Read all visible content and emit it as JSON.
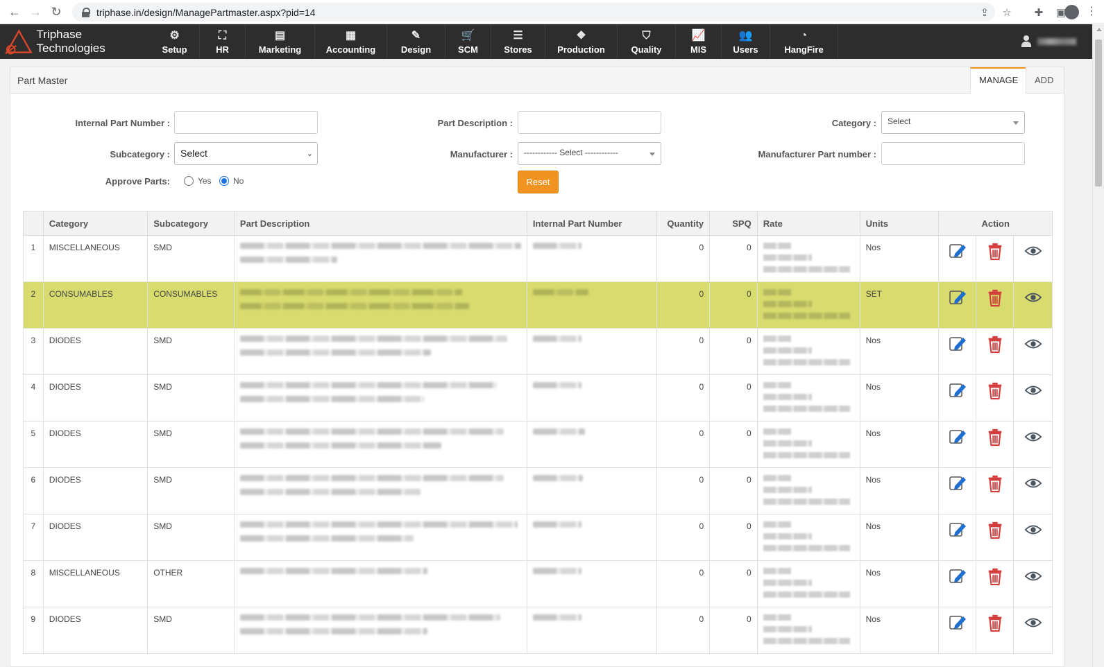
{
  "browser": {
    "url": "triphase.in/design/ManagePartmaster.aspx?pid=14"
  },
  "brand": {
    "name": "Triphase Technologies"
  },
  "nav": [
    {
      "label": "Setup",
      "icon": "gear-icon",
      "glyph": "⚙"
    },
    {
      "label": "HR",
      "icon": "org-chart-icon",
      "glyph": "⛶"
    },
    {
      "label": "Marketing",
      "icon": "briefcase-icon",
      "glyph": "▤"
    },
    {
      "label": "Accounting",
      "icon": "calculator-icon",
      "glyph": "▦"
    },
    {
      "label": "Design",
      "icon": "wrench-icon",
      "glyph": "✎"
    },
    {
      "label": "SCM",
      "icon": "cart-icon",
      "glyph": "🛒"
    },
    {
      "label": "Stores",
      "icon": "database-icon",
      "glyph": "☰"
    },
    {
      "label": "Production",
      "icon": "cubes-icon",
      "glyph": "❖"
    },
    {
      "label": "Quality",
      "icon": "shield-icon",
      "glyph": "⛉"
    },
    {
      "label": "MIS",
      "icon": "chart-icon",
      "glyph": "📈"
    },
    {
      "label": "Users",
      "icon": "users-icon",
      "glyph": "👥"
    },
    {
      "label": "HangFire",
      "icon": "dashboard-icon",
      "glyph": "◔"
    }
  ],
  "panel": {
    "title": "Part Master",
    "tabs": {
      "manage": "MANAGE",
      "add": "ADD"
    }
  },
  "filters": {
    "internal_part_number_label": "Internal Part Number :",
    "part_description_label": "Part Description :",
    "category_label": "Category :",
    "category_value": "Select",
    "subcategory_label": "Subcategory :",
    "subcategory_value": "Select",
    "manufacturer_label": "Manufacturer :",
    "manufacturer_value": "------------ Select ------------",
    "manufacturer_part_label": "Manufacturer Part number :",
    "approve_label": "Approve Parts:",
    "approve_yes": "Yes",
    "approve_no": "No",
    "approve_selected": "No",
    "reset_label": "Reset"
  },
  "table": {
    "headers": {
      "category": "Category",
      "subcategory": "Subcategory",
      "description": "Part Description",
      "ipn": "Internal Part Number",
      "quantity": "Quantity",
      "spq": "SPQ",
      "rate": "Rate",
      "units": "Units",
      "action": "Action"
    },
    "rows": [
      {
        "no": "1",
        "category": "MISCELLANEOUS",
        "subcategory": "SMD",
        "quantity": "0",
        "spq": "0",
        "units": "Nos"
      },
      {
        "no": "2",
        "category": "CONSUMABLES",
        "subcategory": "CONSUMABLES",
        "quantity": "0",
        "spq": "0",
        "units": "SET"
      },
      {
        "no": "3",
        "category": "DIODES",
        "subcategory": "SMD",
        "quantity": "0",
        "spq": "0",
        "units": "Nos"
      },
      {
        "no": "4",
        "category": "DIODES",
        "subcategory": "SMD",
        "quantity": "0",
        "spq": "0",
        "units": "Nos"
      },
      {
        "no": "5",
        "category": "DIODES",
        "subcategory": "SMD",
        "quantity": "0",
        "spq": "0",
        "units": "Nos"
      },
      {
        "no": "6",
        "category": "DIODES",
        "subcategory": "SMD",
        "quantity": "0",
        "spq": "0",
        "units": "Nos"
      },
      {
        "no": "7",
        "category": "DIODES",
        "subcategory": "SMD",
        "quantity": "0",
        "spq": "0",
        "units": "Nos"
      },
      {
        "no": "8",
        "category": "MISCELLANEOUS",
        "subcategory": "OTHER",
        "quantity": "0",
        "spq": "0",
        "units": "Nos"
      },
      {
        "no": "9",
        "category": "DIODES",
        "subcategory": "SMD",
        "quantity": "0",
        "spq": "0",
        "units": "Nos"
      }
    ]
  },
  "colors": {
    "nav_bg": "#2d2d2d",
    "accent_orange": "#f0931f",
    "highlight_row": "#d8dc6e",
    "edit_blue": "#1f6fd1",
    "delete_red": "#d33b3b"
  }
}
